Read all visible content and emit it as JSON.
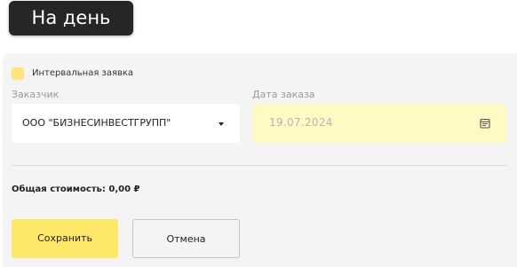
{
  "header": {
    "tab_label": "На день"
  },
  "form": {
    "interval_checkbox_label": "Интервальная заявка",
    "customer_label": "Заказчик",
    "customer_value": "ООО \"БИЗНЕСИНВЕСТГРУПП\"",
    "order_date_label": "Дата заказа",
    "order_date_value": "19.07.2024",
    "total_text": "Общая стоимость: 0,00 ₽",
    "save_label": "Сохранить",
    "cancel_label": "Отмена"
  },
  "icons": {
    "dropdown": "chevron-down-icon",
    "date": "calendar-icon"
  },
  "colors": {
    "accent_yellow": "#ffe769",
    "date_bg": "#fffac4",
    "tab_bg": "#262626",
    "panel_bg": "#f4f4f4"
  }
}
